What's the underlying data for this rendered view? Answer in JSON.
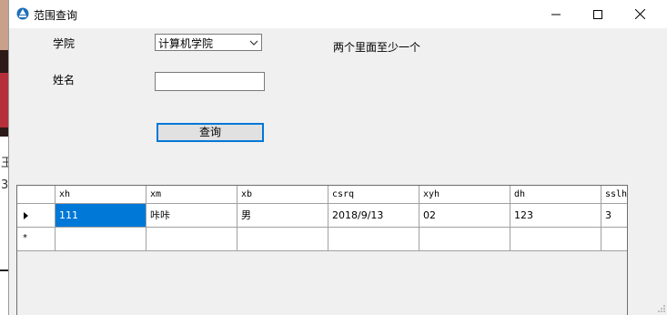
{
  "window": {
    "title": "范围查询"
  },
  "form": {
    "college_label": "学院",
    "college_value": "计算机学院",
    "name_label": "姓名",
    "name_value": "",
    "hint": "两个里面至少一个",
    "query_button": "查询"
  },
  "grid": {
    "columns": [
      "xh",
      "xm",
      "xb",
      "csrq",
      "xyh",
      "dh",
      "sslh"
    ],
    "rows": [
      [
        "111",
        "咔咔",
        "男",
        "2018/9/13",
        "02",
        "123",
        "3"
      ]
    ],
    "new_row_marker": "*"
  },
  "background": {
    "fragment_1": "王",
    "fragment_2": "3"
  },
  "colors": {
    "accent": "#0078d7",
    "window_bg": "#f0f0f0"
  },
  "icons": [
    "app-icon",
    "minimize-icon",
    "maximize-icon",
    "close-icon",
    "chevron-down-icon",
    "row-pointer-icon",
    "size-grip-icon"
  ]
}
